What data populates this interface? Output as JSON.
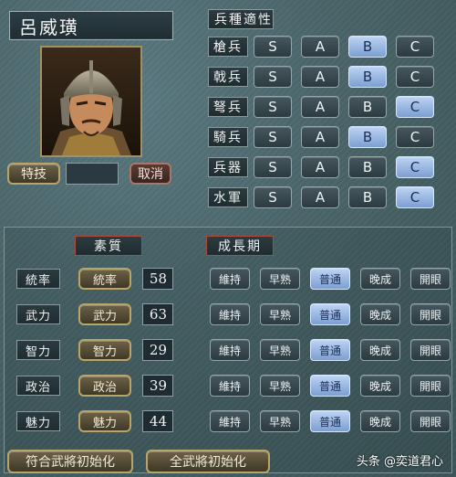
{
  "officer": {
    "name": "呂威璜"
  },
  "buttons": {
    "skill": "特技",
    "cancel": "取消",
    "reset_fitting": "符合武將初始化",
    "reset_all": "全武將初始化"
  },
  "aptitude": {
    "header": "兵種適性",
    "grades": [
      "S",
      "A",
      "B",
      "C"
    ],
    "rows": [
      {
        "label": "槍兵",
        "selected": "B"
      },
      {
        "label": "戟兵",
        "selected": "B"
      },
      {
        "label": "弩兵",
        "selected": "C"
      },
      {
        "label": "騎兵",
        "selected": "B"
      },
      {
        "label": "兵器",
        "selected": "C"
      },
      {
        "label": "水軍",
        "selected": "C"
      }
    ]
  },
  "stats": {
    "headers": {
      "quality": "素質",
      "growth": "成長期"
    },
    "growth_options": [
      "維持",
      "早熟",
      "普通",
      "晚成",
      "開眼"
    ],
    "rows": [
      {
        "label": "統率",
        "button": "統率",
        "value": "58",
        "growth": "普通"
      },
      {
        "label": "武力",
        "button": "武力",
        "value": "63",
        "growth": "普通"
      },
      {
        "label": "智力",
        "button": "智力",
        "value": "29",
        "growth": "普通"
      },
      {
        "label": "政治",
        "button": "政治",
        "value": "39",
        "growth": "普通"
      },
      {
        "label": "魅力",
        "button": "魅力",
        "value": "44",
        "growth": "普通"
      }
    ]
  },
  "watermark": "头条 @奕道君心"
}
